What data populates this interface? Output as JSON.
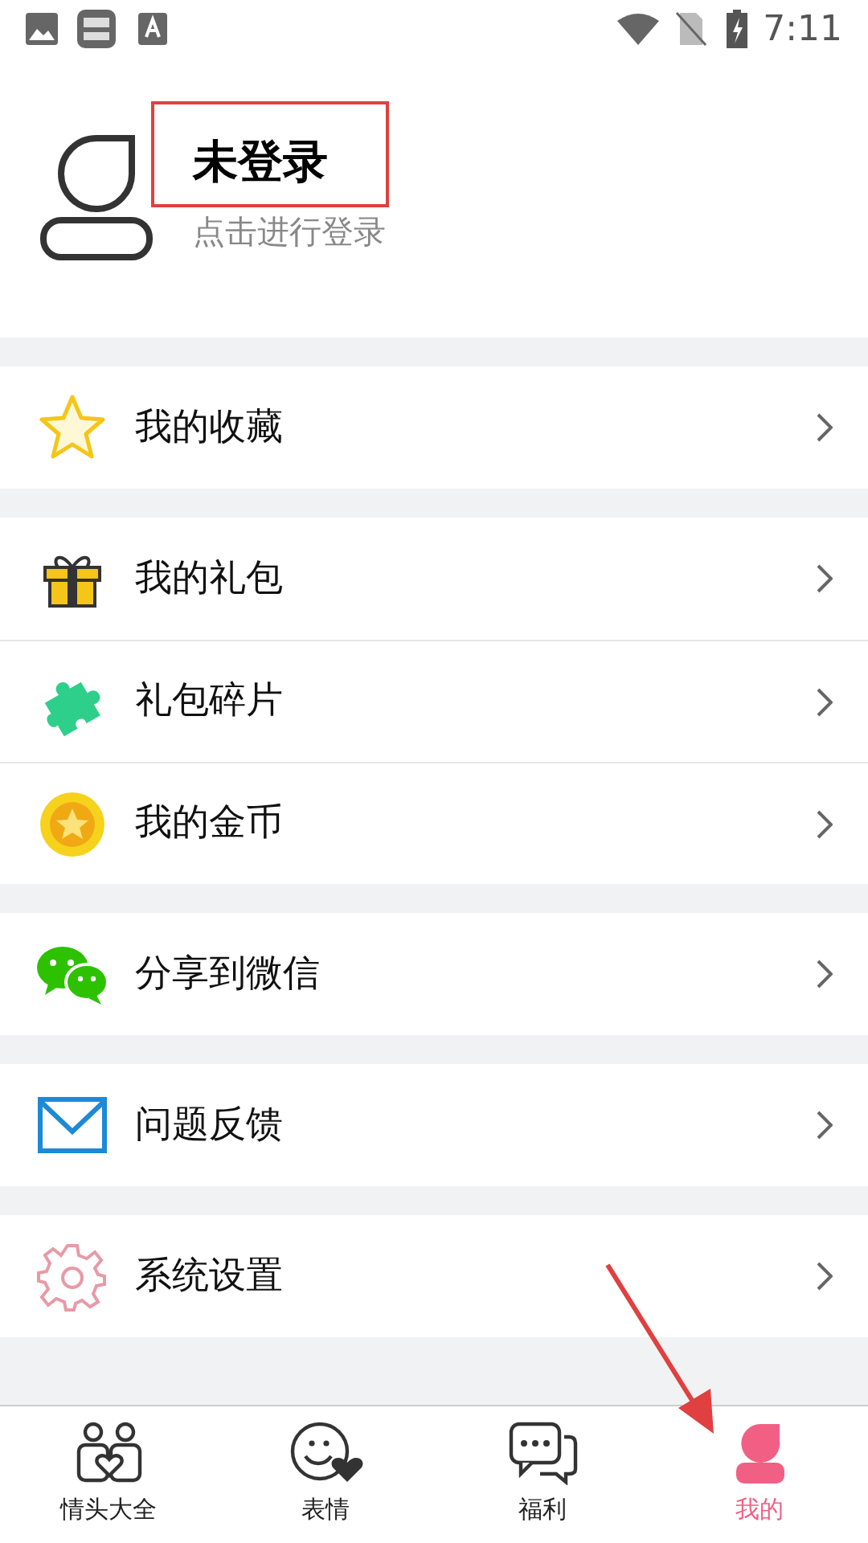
{
  "status_bar": {
    "time": "7:11"
  },
  "profile": {
    "title": "未登录",
    "subtitle": "点击进行登录"
  },
  "menu_groups": [
    {
      "items": [
        {
          "label": "我的收藏"
        }
      ]
    },
    {
      "items": [
        {
          "label": "我的礼包"
        },
        {
          "label": "礼包碎片"
        },
        {
          "label": "我的金币"
        }
      ]
    },
    {
      "items": [
        {
          "label": "分享到微信"
        }
      ]
    },
    {
      "items": [
        {
          "label": "问题反馈"
        }
      ]
    },
    {
      "items": [
        {
          "label": "系统设置"
        }
      ]
    }
  ],
  "tabs": [
    {
      "label": "情头大全",
      "selected": false
    },
    {
      "label": "表情",
      "selected": false
    },
    {
      "label": "福利",
      "selected": false
    },
    {
      "label": "我的",
      "selected": true
    }
  ]
}
